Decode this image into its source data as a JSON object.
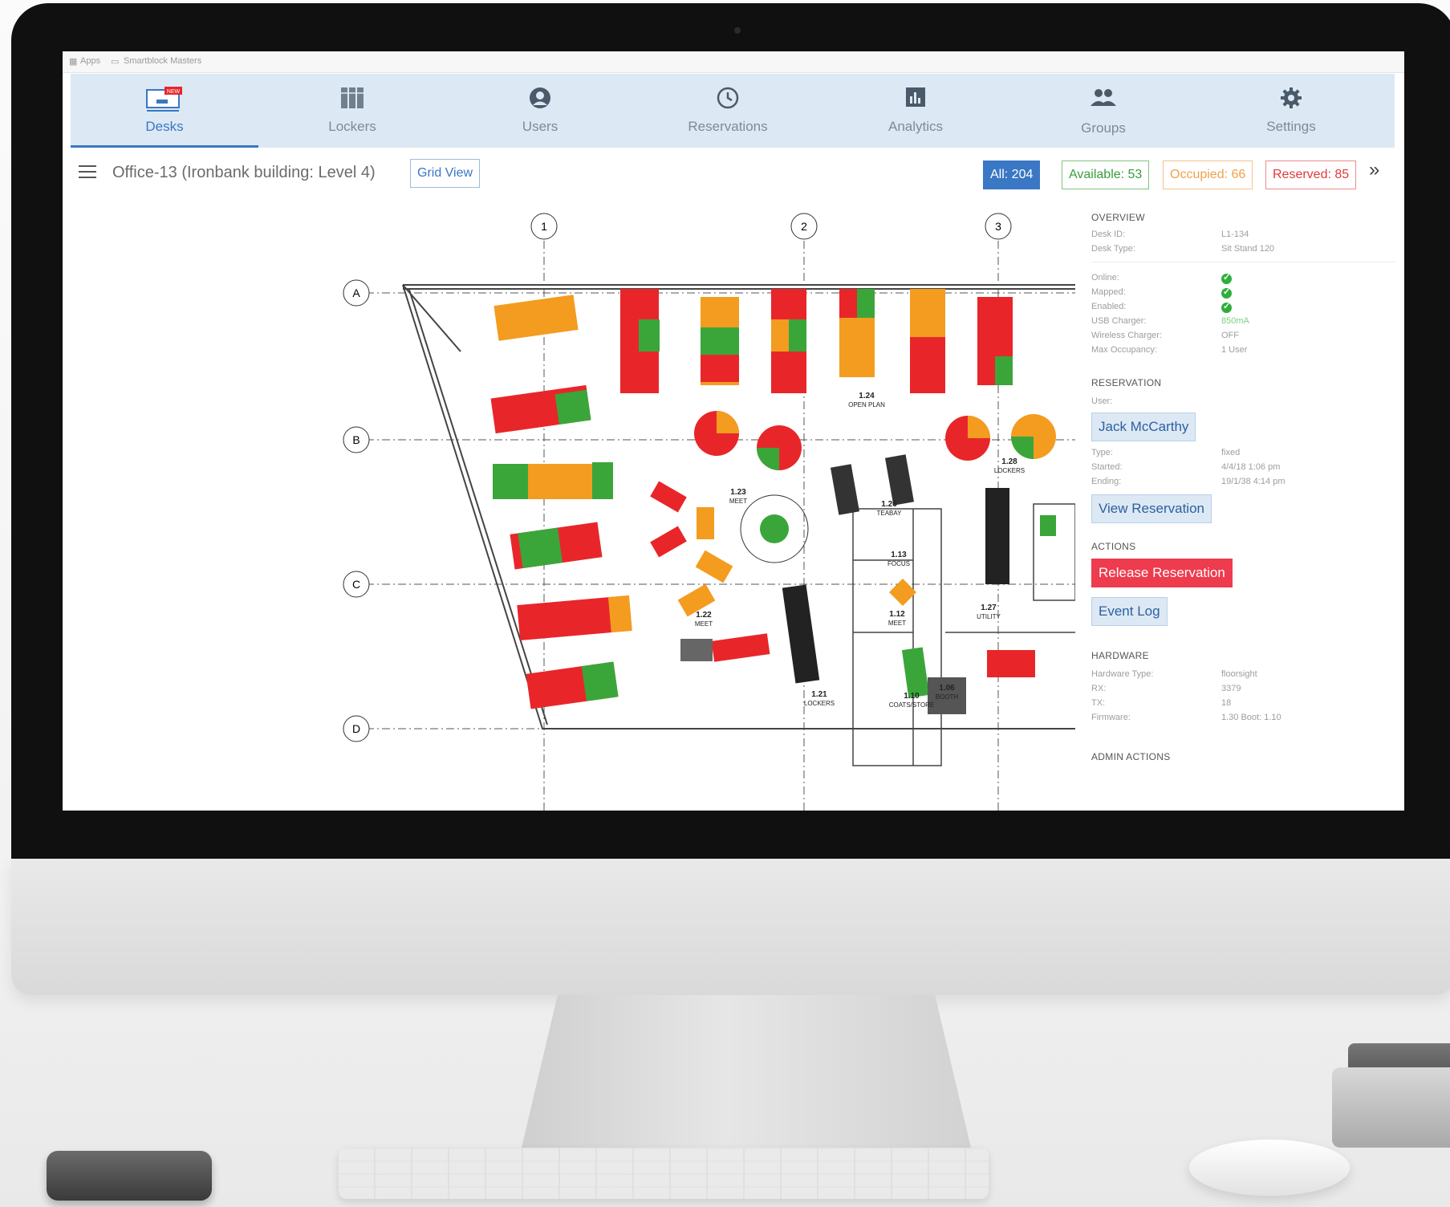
{
  "browser": {
    "items": [
      "Apps",
      "Smartblock Masters"
    ]
  },
  "nav": {
    "tabs": [
      {
        "label": "Desks",
        "icon": "desk-icon",
        "badge": "NEW",
        "active": true
      },
      {
        "label": "Lockers",
        "icon": "lockers-icon",
        "active": false
      },
      {
        "label": "Users",
        "icon": "user-icon",
        "active": false
      },
      {
        "label": "Reservations",
        "icon": "clock-icon",
        "active": false
      },
      {
        "label": "Analytics",
        "icon": "bar-chart-icon",
        "active": false
      },
      {
        "label": "Groups",
        "icon": "group-icon",
        "active": false
      },
      {
        "label": "Settings",
        "icon": "gear-icon",
        "active": false
      }
    ]
  },
  "toolbar": {
    "title": "Office-13 (Ironbank building: Level 4)",
    "grid_view": "Grid View",
    "stats": {
      "all": "All: 204",
      "available": "Available: 53",
      "occupied": "Occupied: 66",
      "reserved": "Reserved: 85"
    },
    "expand_icon": "double-chevron-right-icon"
  },
  "floorplan": {
    "columns": [
      "1",
      "2",
      "3"
    ],
    "rows": [
      "A",
      "B",
      "C",
      "D"
    ],
    "rooms": [
      {
        "num": "1.24",
        "name": "OPEN PLAN"
      },
      {
        "num": "1.23",
        "name": "MEET"
      },
      {
        "num": "1.26",
        "name": "TEABAY"
      },
      {
        "num": "1.28",
        "name": "LOCKERS"
      },
      {
        "num": "1.13",
        "name": "FOCUS"
      },
      {
        "num": "1.12",
        "name": "MEET"
      },
      {
        "num": "1.22",
        "name": "MEET"
      },
      {
        "num": "1.27",
        "name": "UTILITY"
      },
      {
        "num": "1.21",
        "name": "LOCKERS"
      },
      {
        "num": "1.10",
        "name": "COATS/STORE"
      },
      {
        "num": "1.06",
        "name": "BOOTH"
      }
    ],
    "colors": {
      "available": "#3aa63a",
      "occupied": "#f39c1f",
      "reserved": "#e8262a"
    }
  },
  "panel": {
    "overview": {
      "title": "OVERVIEW",
      "desk_id_label": "Desk ID:",
      "desk_id": "L1-134",
      "desk_type_label": "Desk Type:",
      "desk_type": "Sit Stand 120",
      "online_label": "Online:",
      "mapped_label": "Mapped:",
      "enabled_label": "Enabled:",
      "usb_label": "USB Charger:",
      "usb": "850mA",
      "wireless_label": "Wireless Charger:",
      "wireless": "OFF",
      "max_label": "Max Occupancy:",
      "max": "1 User"
    },
    "reservation": {
      "title": "RESERVATION",
      "user_label": "User:",
      "user": "Jack McCarthy",
      "type_label": "Type:",
      "type": "fixed",
      "started_label": "Started:",
      "started": "4/4/18 1:06 pm",
      "ending_label": "Ending:",
      "ending": "19/1/38 4:14 pm",
      "view_button": "View Reservation"
    },
    "actions": {
      "title": "ACTIONS",
      "release_button": "Release Reservation",
      "event_log_button": "Event Log"
    },
    "hardware": {
      "title": "HARDWARE",
      "hw_type_label": "Hardware Type:",
      "hw_type": "floorsight",
      "rx_label": "RX:",
      "rx": "3379",
      "tx_label": "TX:",
      "tx": "18",
      "firmware_label": "Firmware:",
      "firmware": "1.30 Boot: 1.10"
    },
    "admin": {
      "title": "ADMIN ACTIONS"
    }
  }
}
